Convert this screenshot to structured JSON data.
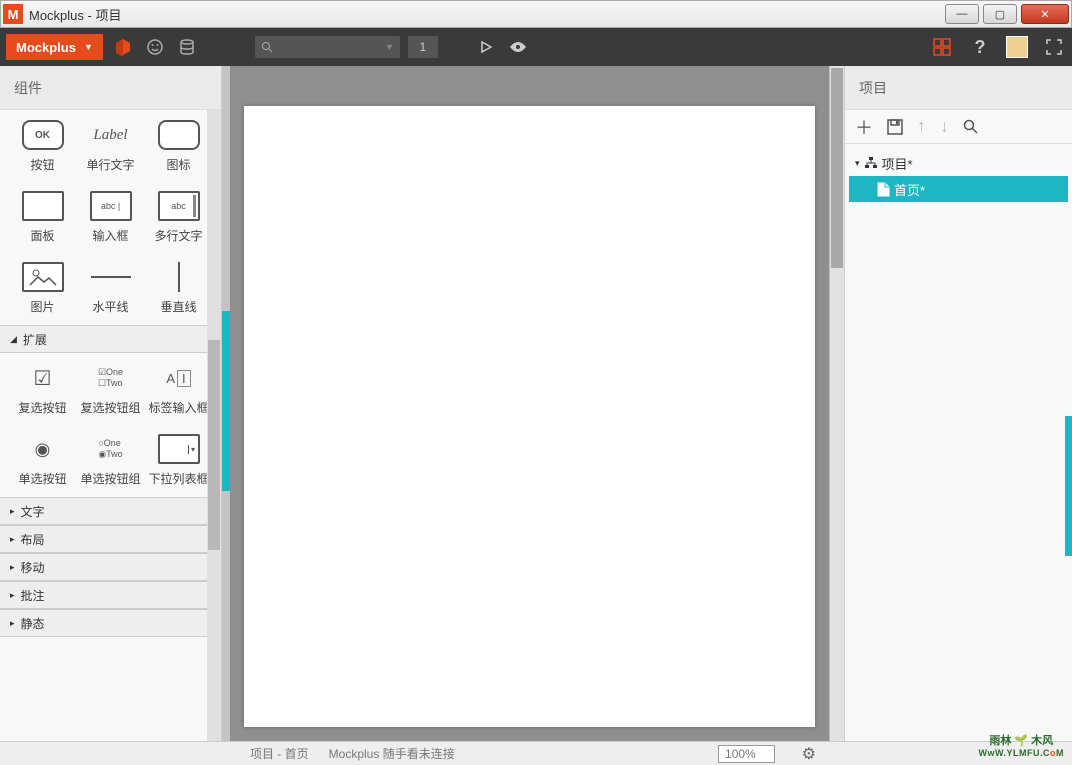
{
  "window": {
    "title": "Mockplus - 项目"
  },
  "brand": {
    "name": "Mockplus"
  },
  "toolbar": {
    "page_count": "1"
  },
  "sidebar_left": {
    "title": "组件",
    "basic": [
      {
        "label": "按钮",
        "text": "OK"
      },
      {
        "label": "单行文字",
        "text": "Label"
      },
      {
        "label": "图标",
        "text": ""
      },
      {
        "label": "面板",
        "text": ""
      },
      {
        "label": "输入框",
        "text": "abc"
      },
      {
        "label": "多行文字",
        "text": "abc"
      },
      {
        "label": "图片",
        "text": ""
      },
      {
        "label": "水平线",
        "text": ""
      },
      {
        "label": "垂直线",
        "text": ""
      }
    ],
    "ext_title": "扩展",
    "ext": [
      {
        "label": "复选按钮",
        "text": "☑"
      },
      {
        "label": "复选按钮组",
        "text": "☑One\n☐Two"
      },
      {
        "label": "标签输入框",
        "text": "A I"
      },
      {
        "label": "单选按钮",
        "text": "◉"
      },
      {
        "label": "单选按钮组",
        "text": "○One\n◉Two"
      },
      {
        "label": "下拉列表框",
        "text": "▭▾"
      }
    ],
    "sections": [
      "文字",
      "布局",
      "移动",
      "批注",
      "静态"
    ]
  },
  "sidebar_right": {
    "title": "项目",
    "root": "项目*",
    "page": "首页*"
  },
  "statusbar": {
    "path": "项目 - 首页",
    "msg": "Mockplus 随手看未连接",
    "zoom": "100%"
  },
  "watermark": {
    "line1": "雨林 🌱 木风",
    "line2_a": "WwW.YLMFU.C",
    "line2_b": "o",
    "line2_c": "M"
  }
}
